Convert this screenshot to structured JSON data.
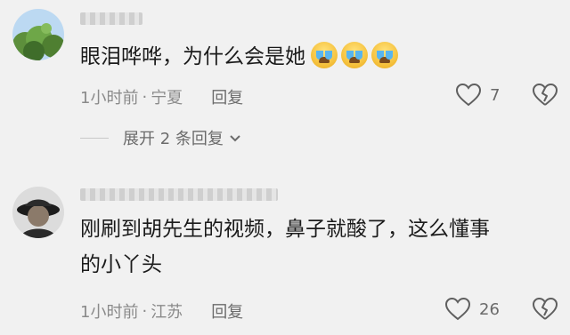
{
  "comments": [
    {
      "text": "眼泪哗哗，为什么会是她",
      "emojis": [
        "loudly-crying-face",
        "loudly-crying-face",
        "loudly-crying-face"
      ],
      "time": "1小时前",
      "separator": "·",
      "location": "宁夏",
      "reply_label": "回复",
      "likes": "7",
      "expand_replies": "展开 2 条回复"
    },
    {
      "text_line1": "刚刷到胡先生的视频，鼻子就酸了，这么懂事",
      "text_line2": "的小丫头",
      "time": "1小时前",
      "separator": "·",
      "location": "江苏",
      "reply_label": "回复",
      "likes": "26"
    }
  ],
  "colors": {
    "background": "#f1f1f1",
    "text": "#1b1b1b",
    "meta": "#8a8a8a"
  }
}
